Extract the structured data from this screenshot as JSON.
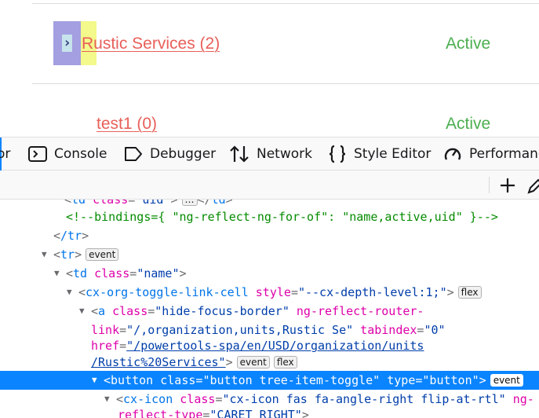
{
  "page": {
    "rows": [
      {
        "name": "Rustic Services (2)",
        "status": "Active"
      },
      {
        "name": "test1 (0)",
        "status": "Active"
      }
    ],
    "toggle_icon": "chevron-right-icon",
    "toggle_glyph": "›"
  },
  "devtools": {
    "tabs": [
      {
        "label": "or",
        "icon": "inspector-icon"
      },
      {
        "label": "Console",
        "icon": "console-icon"
      },
      {
        "label": "Debugger",
        "icon": "debugger-icon"
      },
      {
        "label": "Network",
        "icon": "network-icon"
      },
      {
        "label": "Style Editor",
        "icon": "braces-icon"
      },
      {
        "label": "Performance",
        "icon": "gauge-icon"
      }
    ],
    "toolbar": {
      "add_glyph": "+"
    },
    "accent": "#0a84ff",
    "tree": {
      "l0_tag": "td",
      "l0_attr": "class",
      "l0_val": "\"uid\"",
      "l0_close": "></td>",
      "l1_comment": "<!--bindings={ \"ng-reflect-ng-for-of\": \"name,active,uid\" }-->",
      "l2_close_tag": "/tr",
      "l3_tag": "tr",
      "l4_tag": "td",
      "l4_attr": "class",
      "l4_val": "\"name\"",
      "l5_tag": "cx-org-toggle-link-cell",
      "l5_attr": "style",
      "l5_val": "\"--cx-depth-level:1;\"",
      "l6_tag": "a",
      "l6_attr1": "class",
      "l6_val1": "\"hide-focus-border\"",
      "l6_attr2": "ng-reflect-router-",
      "l7_attr2b": "link",
      "l7_val2": "\"/,organization,units,Rustic Se\"",
      "l7_attr3": "tabindex",
      "l7_val3": "\"0\"",
      "l8_attr4": "href",
      "l8_val4": "\"/powertools-spa/en/USD/organization/units",
      "l9_val4b": "/Rustic%20Services\"",
      "l10_tag": "button",
      "l10_attr1": "class",
      "l10_val1": "\"button tree-item-toggle\"",
      "l10_attr2": "type",
      "l10_val2": "\"button\"",
      "l11_tag": "cx-icon",
      "l11_attr1": "class",
      "l11_val1": "\"cx-icon fas fa-angle-right flip-at-rtl\"",
      "l11_attr2": "ng-",
      "l12_attr2b": "reflect-type",
      "l12_val2": "\"CARET_RIGHT\"",
      "badge_event": "event",
      "badge_flex": "flex",
      "badge_ellipsis": "…"
    }
  }
}
